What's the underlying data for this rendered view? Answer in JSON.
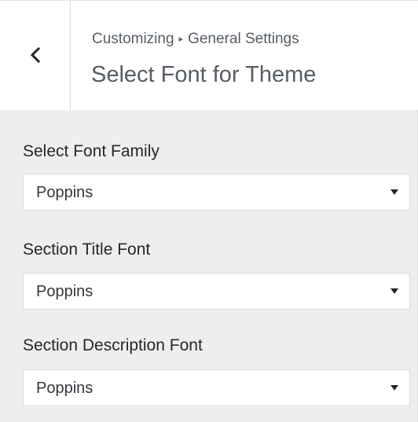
{
  "header": {
    "breadcrumb_parent": "Customizing",
    "breadcrumb_separator": "▸",
    "breadcrumb_child": "General Settings",
    "title": "Select Font for Theme"
  },
  "controls": [
    {
      "label": "Select Font Family",
      "value": "Poppins"
    },
    {
      "label": "Section Title Font",
      "value": "Poppins"
    },
    {
      "label": "Section Description Font",
      "value": "Poppins"
    }
  ],
  "icons": {
    "back": "chevron-left-icon",
    "dropdown": "caret-down-icon"
  },
  "colors": {
    "panel_background": "#eeeeee",
    "header_background": "#ffffff",
    "text": "#23282d",
    "muted_text": "#555d66"
  }
}
